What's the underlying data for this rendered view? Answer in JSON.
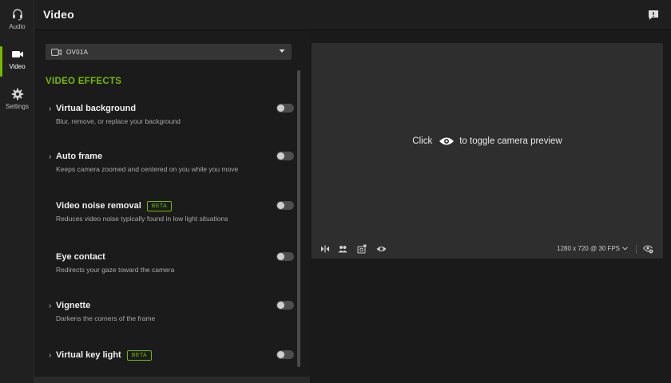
{
  "sidebar": {
    "items": [
      {
        "label": "Audio",
        "icon": "headset-icon"
      },
      {
        "label": "Video",
        "icon": "video-camera-icon",
        "active": true
      },
      {
        "label": "Settings",
        "icon": "gear-icon"
      }
    ]
  },
  "header": {
    "title": "Video",
    "feedback_icon": "feedback-icon"
  },
  "device": {
    "selected": "OV01A"
  },
  "effects": {
    "title": "VIDEO EFFECTS",
    "items": [
      {
        "name": "Virtual background",
        "desc": "Blur, remove, or replace your background",
        "expandable": true,
        "beta": "",
        "enabled": false
      },
      {
        "name": "Auto frame",
        "desc": "Keeps camera zoomed and centered on you while you move",
        "expandable": true,
        "beta": "",
        "enabled": false
      },
      {
        "name": "Video noise removal",
        "desc": "Reduces video noise typically found in low light situations",
        "expandable": false,
        "beta": "BETA",
        "enabled": false
      },
      {
        "name": "Eye contact",
        "desc": "Redirects your gaze toward the camera",
        "expandable": false,
        "beta": "",
        "enabled": false
      },
      {
        "name": "Vignette",
        "desc": "Darkens the corners of the frame",
        "expandable": true,
        "beta": "",
        "enabled": false
      },
      {
        "name": "Virtual key light",
        "desc": "",
        "expandable": true,
        "beta": "BETA",
        "enabled": false
      }
    ]
  },
  "preview": {
    "msg_before": "Click",
    "msg_after": "to toggle camera preview",
    "resolution": "1280 x 720 @ 30 FPS"
  },
  "colors": {
    "accent": "#76b900",
    "background": "#1a1a1a",
    "preview": "#2e2e2e"
  }
}
